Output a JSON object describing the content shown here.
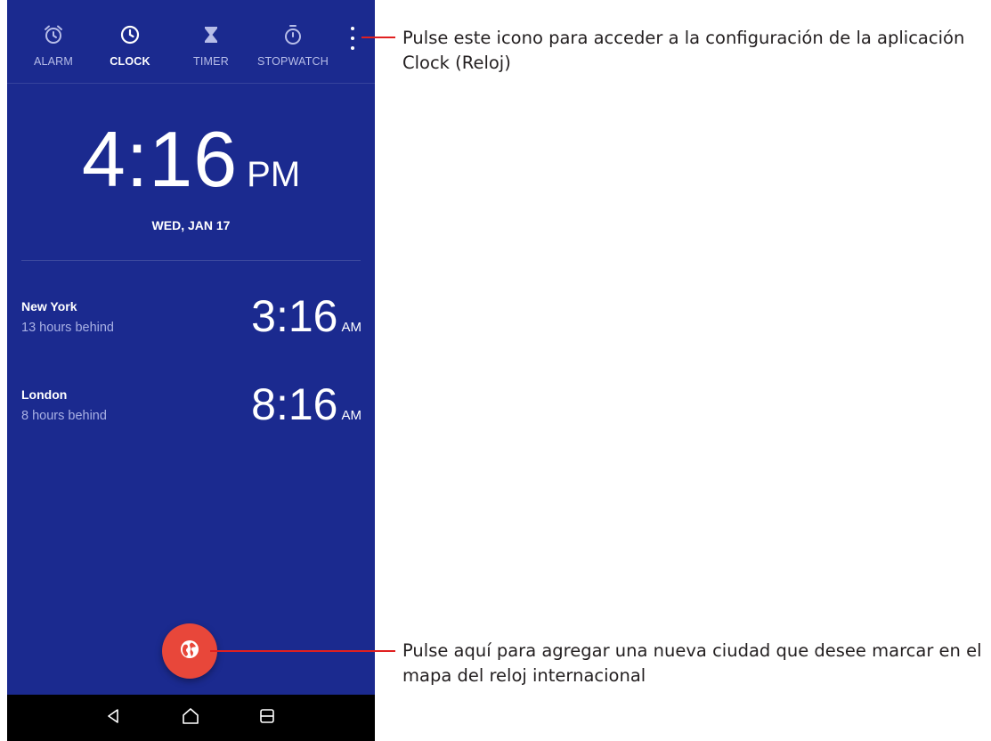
{
  "tabs": [
    {
      "label": "ALARM",
      "icon": "alarm-clock-icon",
      "active": false
    },
    {
      "label": "CLOCK",
      "icon": "clock-icon",
      "active": true
    },
    {
      "label": "TIMER",
      "icon": "hourglass-icon",
      "active": false
    },
    {
      "label": "STOPWATCH",
      "icon": "stopwatch-icon",
      "active": false
    }
  ],
  "main_clock": {
    "time": "4:16",
    "ampm": "PM",
    "date": "WED, JAN 17"
  },
  "cities": [
    {
      "name": "New York",
      "diff": "13 hours behind",
      "time": "3:16",
      "ampm": "AM"
    },
    {
      "name": "London",
      "diff": "8 hours behind",
      "time": "8:16",
      "ampm": "AM"
    }
  ],
  "fab": {
    "icon": "globe-icon"
  },
  "nav": {
    "back_icon": "back-triangle-icon",
    "home_icon": "home-icon",
    "recents_icon": "recents-icon"
  },
  "annotations": {
    "settings_line1": "Pulse este icono para acceder a la configuración de la aplicación",
    "settings_line2": "Clock (Reloj)",
    "add_city_line1": "Pulse aquí para agregar una nueva ciudad que desee marcar en el",
    "add_city_line2": "mapa del reloj internacional"
  },
  "colors": {
    "background": "#1b2a8f",
    "fab": "#e8473a",
    "callout_line": "#e02020",
    "navbar": "#000000"
  }
}
